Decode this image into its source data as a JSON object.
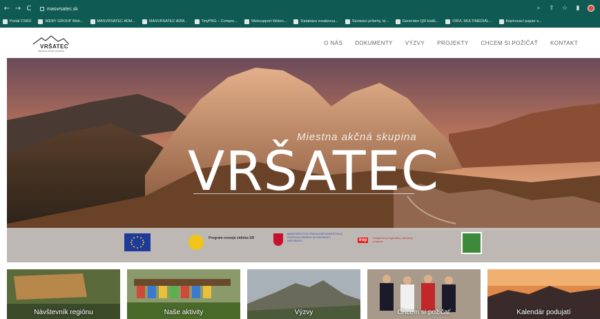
{
  "browser": {
    "url": "masvrsatec.sk",
    "bookmarks": [
      "Portál CSRÚ",
      "WEBY GROUP Web...",
      "MASVRSATEC ADM...",
      "MASVRSATEC ADM...",
      "TinyPNG – Compre...",
      "Websupport Webm...",
      "Databáza zrealizova...",
      "Súvisiaci príbehy, kl...",
      "Generátor QR kódů...",
      "ORVL MULTIMEDIÁL...",
      "Kopírovací papier s..."
    ]
  },
  "site": {
    "logo_text": "VRŠATEC",
    "logo_sub": "MIESTNA AKČNÁ SKUPINA",
    "nav": [
      "O NÁS",
      "DOKUMENTY",
      "VÝZVY",
      "PROJEKTY",
      "CHCEM SI POŽIČAŤ",
      "KONTAKT"
    ]
  },
  "hero": {
    "subtitle": "Miestna akčná skupina",
    "title": "VRŠATEC"
  },
  "partner_logos": {
    "program_text": "Program rozvoja vidieka SR",
    "ministry_text": "MINISTERSTVO PÔDOHOSPODÁRSTVA A ROZVOJA VIDIEKA SLOVENSKEJ REPUBLIKY",
    "irop_badge": "irop",
    "irop_text": "Integrovaný regionálny operačný program"
  },
  "tiles": [
    {
      "label": "Návštevník regiónu"
    },
    {
      "label": "Naše aktivity"
    },
    {
      "label": "Výzvy"
    },
    {
      "label": "Chcem si požičať"
    },
    {
      "label": "Kalendár podujatí"
    }
  ]
}
